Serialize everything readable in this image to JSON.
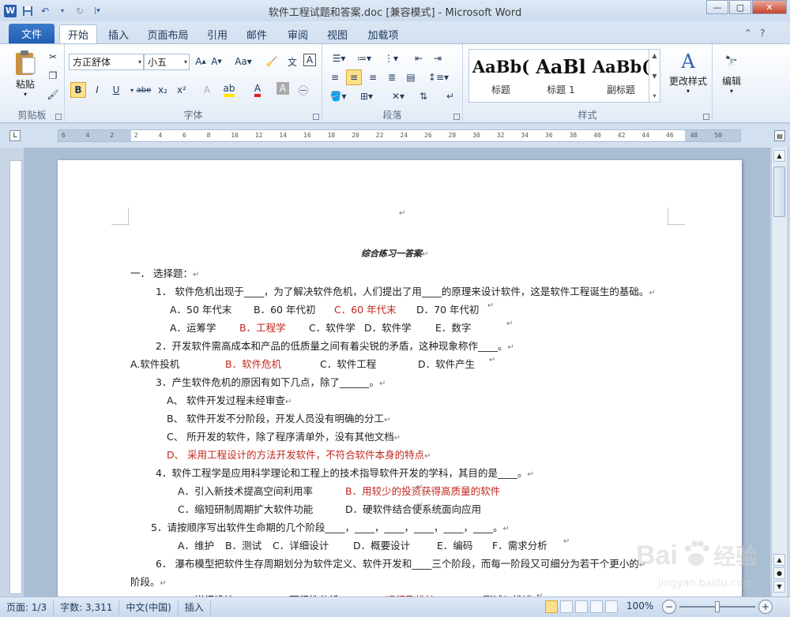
{
  "window": {
    "title": "软件工程试题和答案.doc [兼容模式] - Microsoft Word",
    "app_icon_letter": "W",
    "qat": [
      "save-icon",
      "undo-icon",
      "redo-icon"
    ]
  },
  "tabs": {
    "file": "文件",
    "items": [
      "开始",
      "插入",
      "页面布局",
      "引用",
      "邮件",
      "审阅",
      "视图",
      "加载项"
    ],
    "active": "开始"
  },
  "ribbon": {
    "clipboard": {
      "paste": "粘贴",
      "label": "剪贴板"
    },
    "font": {
      "family": "方正舒体",
      "size": "小五",
      "label": "字体",
      "buttons": [
        "B",
        "I",
        "U",
        "abe",
        "x₂",
        "x²"
      ]
    },
    "paragraph": {
      "label": "段落"
    },
    "styles": {
      "label": "样式",
      "items": [
        {
          "preview": "AaBb(",
          "name": "标题"
        },
        {
          "preview": "AaBl",
          "name": "标题 1"
        },
        {
          "preview": "AaBb(",
          "name": "副标题"
        }
      ],
      "change_styles": "更改样式"
    },
    "editing": {
      "label": "编辑"
    }
  },
  "ruler": {
    "ticks": [
      "6",
      "4",
      "2",
      "2",
      "4",
      "6",
      "8",
      "10",
      "12",
      "14",
      "16",
      "18",
      "20",
      "22",
      "24",
      "26",
      "28",
      "30",
      "32",
      "34",
      "36",
      "38",
      "40",
      "42",
      "44",
      "46",
      "48",
      "50"
    ]
  },
  "document": {
    "mark": "↵",
    "title": "综合练习一答案",
    "lines": [
      {
        "text": "一． 选择题：",
        "red": []
      },
      {
        "text": "1．  软件危机出现于____，为了解决软件危机，人们提出了用____的原理来设计软件，这是软件工程诞生的基础。",
        "red": []
      },
      {
        "parts": [
          [
            "A．50 年代末",
            false
          ],
          [
            "B．60 年代初",
            false
          ],
          [
            "C．60 年代末",
            true
          ],
          [
            "D．70 年代初",
            false
          ]
        ]
      },
      {
        "parts": [
          [
            "A．运筹学",
            false
          ],
          [
            "B．工程学",
            true
          ],
          [
            "C．软件学",
            false
          ],
          [
            "D．软件学",
            false
          ],
          [
            "E．数字",
            false
          ]
        ]
      },
      {
        "text": "2．开发软件需高成本和产品的低质量之间有着尖锐的矛盾，这种现象称作____。",
        "red": []
      },
      {
        "parts": [
          [
            "A.软件投机",
            false
          ],
          [
            "B．软件危机",
            true
          ],
          [
            "C．软件工程",
            false
          ],
          [
            "D．软件产生",
            false
          ]
        ]
      },
      {
        "text": "3．产生软件危机的原因有如下几点，除了______。",
        "red": []
      },
      {
        "text": "A、  软件开发过程未经审查",
        "red": []
      },
      {
        "text": "B、  软件开发不分阶段，开发人员没有明确的分工",
        "red": []
      },
      {
        "text": "C、  所开发的软件，除了程序清单外，没有其他文档",
        "red": []
      },
      {
        "text": "D、  采用工程设计的方法开发软件，不符合软件本身的特点",
        "red": [
          true
        ]
      },
      {
        "text": "4．软件工程学是应用科学理论和工程上的技术指导软件开发的学科，其目的是____。",
        "red": []
      },
      {
        "parts": [
          [
            "A．引入新技术提高空间利用率",
            false
          ],
          [
            "B．用较少的投资获得高质量的软件",
            true
          ]
        ]
      },
      {
        "parts": [
          [
            "C．缩短研制周期扩大软件功能",
            false
          ],
          [
            "D．硬软件结合使系统面向应用",
            false
          ]
        ]
      },
      {
        "text": "5．请按顺序写出软件生命期的几个阶段____，____，____，____，____，____。",
        "red": []
      },
      {
        "parts": [
          [
            "A．维护",
            false
          ],
          [
            "B．测试",
            false
          ],
          [
            "C．详细设计",
            false
          ],
          [
            "D．概要设计",
            false
          ],
          [
            "E．编码",
            false
          ],
          [
            "F．需求分析",
            false
          ]
        ]
      },
      {
        "text": "6．  瀑布模型把软件生存周期划分为软件定义、软件开发和____三个阶段，而每一阶段又可细分为若干个更小的",
        "red": []
      },
      {
        "text": "阶段。",
        "red": []
      },
      {
        "parts": [
          [
            "A．详细设计",
            false
          ],
          [
            "B．可行性分析",
            false
          ],
          [
            "C．运行及维护",
            true
          ],
          [
            "D．测试与排错",
            false
          ]
        ]
      }
    ]
  },
  "statusbar": {
    "page": "页面: 1/3",
    "words": "字数: 3,311",
    "language": "中文(中国)",
    "mode": "插入",
    "zoom": "100%",
    "zoom_level": 0.5
  },
  "watermark": {
    "brand": "Bai",
    "brand_cn": "经验",
    "url": "jingyan.baidu.com"
  }
}
